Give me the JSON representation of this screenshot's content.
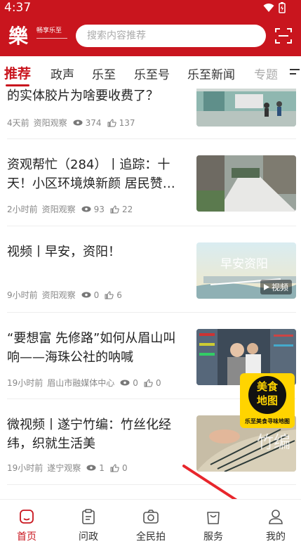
{
  "status_bar": {
    "time": "4:37"
  },
  "header": {
    "logo_text": "樂",
    "logo_sub": "畅享乐至",
    "search_placeholder": "搜索内容推荐"
  },
  "tabs": [
    "推荐",
    "政声",
    "乐至",
    "乐至号",
    "乐至新闻",
    "专题"
  ],
  "feed": [
    {
      "title": "的实体胶片为啥要收费了？",
      "time": "4天前",
      "source": "资阳观察",
      "views": "374",
      "likes": "137",
      "thumb": "hospital-lobby"
    },
    {
      "title": "资观帮忙（284）丨追踪：十天！小区环境焕新颜 居民赞…",
      "time": "2小时前",
      "source": "资阳观察",
      "views": "93",
      "likes": "22",
      "thumb": "residential-area"
    },
    {
      "title": "视频丨早安，资阳！",
      "time": "9小时前",
      "source": "资阳观察",
      "views": "0",
      "likes": "6",
      "thumb": "morning-city",
      "thumb_text": "早安资阳",
      "badge": "视频"
    },
    {
      "title": "“要想富 先修路”如何从眉山叫响——海珠公社的呐喊",
      "time": "19小时前",
      "source": "眉山市融媒体中心",
      "views": "0",
      "likes": "0",
      "thumb": "library"
    },
    {
      "title": "微视频丨遂宁竹编：竹丝化经纬，织就生活美",
      "time": "19小时前",
      "source": "遂宁观察",
      "views": "1",
      "likes": "0",
      "thumb": "bamboo-weaving",
      "thumb_text": "竹编"
    }
  ],
  "float_ad": {
    "line1": "美食",
    "line2": "地图",
    "caption": "乐至美食寻味地图"
  },
  "bottom_nav": [
    {
      "label": "首页",
      "icon": "home-icon",
      "active": true
    },
    {
      "label": "问政",
      "icon": "clipboard-icon",
      "active": false
    },
    {
      "label": "全民拍",
      "icon": "camera-icon",
      "active": false
    },
    {
      "label": "服务",
      "icon": "bag-icon",
      "active": false
    },
    {
      "label": "我的",
      "icon": "person-icon",
      "active": false
    }
  ],
  "colors": {
    "brand": "#c9151e",
    "meta": "#888888"
  }
}
